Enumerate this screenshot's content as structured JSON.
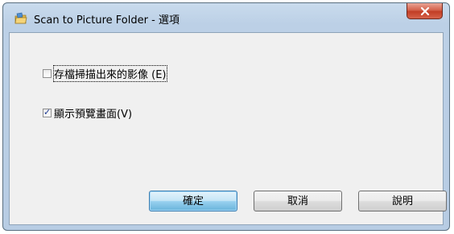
{
  "window": {
    "title": "Scan to Picture Folder - 選項",
    "icon": "folder-scan-icon"
  },
  "options": {
    "save_scanned_images": {
      "label": "存檔掃描出來的影像 (E)",
      "checked": false
    },
    "show_preview": {
      "label": "顯示預覽畫面(V)",
      "checked": true
    }
  },
  "buttons": {
    "ok": "確定",
    "cancel": "取消",
    "help": "說明"
  },
  "colors": {
    "close_button": "#c13e25",
    "window_frame": "#b7cce3",
    "client_area": "#f0f0f0",
    "check_mark": "#1f3a93"
  }
}
